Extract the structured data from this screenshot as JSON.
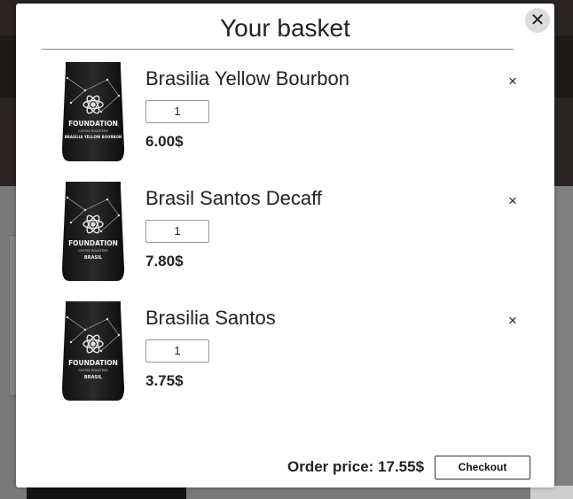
{
  "modal": {
    "title": "Your basket",
    "close_icon": "close-icon"
  },
  "items": [
    {
      "name": "Brasilia Yellow Bourbon",
      "quantity": "1",
      "price": "6.00$",
      "pack_brand": "FOUNDATION",
      "pack_sub": "COFFEE ROASTERS",
      "pack_line": "BRASILIA YELLOW BOURBON",
      "remove_icon": "×"
    },
    {
      "name": "Brasil Santos Decaff",
      "quantity": "1",
      "price": "7.80$",
      "pack_brand": "FOUNDATION",
      "pack_sub": "COFFEE ROASTERS",
      "pack_line": "BRASIL",
      "remove_icon": "×"
    },
    {
      "name": "Brasilia Santos",
      "quantity": "1",
      "price": "3.75$",
      "pack_brand": "FOUNDATION",
      "pack_sub": "COFFEE ROASTERS",
      "pack_line": "BRASIL",
      "remove_icon": "×"
    }
  ],
  "footer": {
    "order_price": "Order price: 17.55$",
    "checkout_label": "Checkout"
  },
  "colors": {
    "modal_bg": "#ffffff",
    "text": "#222222",
    "backdrop": "#6e6e6e"
  }
}
